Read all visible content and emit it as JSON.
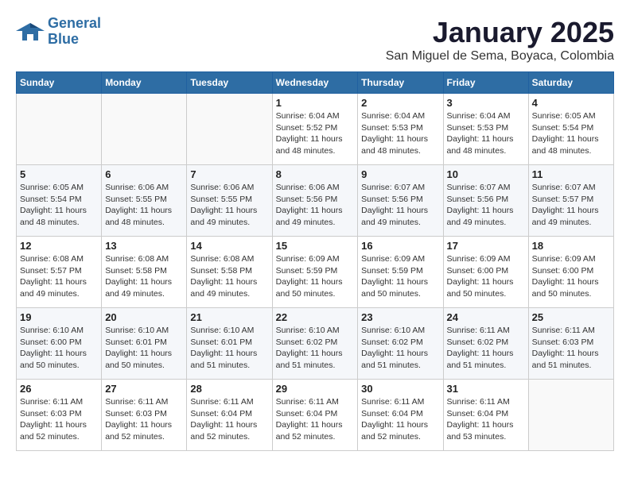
{
  "header": {
    "logo_line1": "General",
    "logo_line2": "Blue",
    "month": "January 2025",
    "location": "San Miguel de Sema, Boyaca, Colombia"
  },
  "weekdays": [
    "Sunday",
    "Monday",
    "Tuesday",
    "Wednesday",
    "Thursday",
    "Friday",
    "Saturday"
  ],
  "weeks": [
    [
      {
        "day": "",
        "sunrise": "",
        "sunset": "",
        "daylight": ""
      },
      {
        "day": "",
        "sunrise": "",
        "sunset": "",
        "daylight": ""
      },
      {
        "day": "",
        "sunrise": "",
        "sunset": "",
        "daylight": ""
      },
      {
        "day": "1",
        "sunrise": "Sunrise: 6:04 AM",
        "sunset": "Sunset: 5:52 PM",
        "daylight": "Daylight: 11 hours and 48 minutes."
      },
      {
        "day": "2",
        "sunrise": "Sunrise: 6:04 AM",
        "sunset": "Sunset: 5:53 PM",
        "daylight": "Daylight: 11 hours and 48 minutes."
      },
      {
        "day": "3",
        "sunrise": "Sunrise: 6:04 AM",
        "sunset": "Sunset: 5:53 PM",
        "daylight": "Daylight: 11 hours and 48 minutes."
      },
      {
        "day": "4",
        "sunrise": "Sunrise: 6:05 AM",
        "sunset": "Sunset: 5:54 PM",
        "daylight": "Daylight: 11 hours and 48 minutes."
      }
    ],
    [
      {
        "day": "5",
        "sunrise": "Sunrise: 6:05 AM",
        "sunset": "Sunset: 5:54 PM",
        "daylight": "Daylight: 11 hours and 48 minutes."
      },
      {
        "day": "6",
        "sunrise": "Sunrise: 6:06 AM",
        "sunset": "Sunset: 5:55 PM",
        "daylight": "Daylight: 11 hours and 48 minutes."
      },
      {
        "day": "7",
        "sunrise": "Sunrise: 6:06 AM",
        "sunset": "Sunset: 5:55 PM",
        "daylight": "Daylight: 11 hours and 49 minutes."
      },
      {
        "day": "8",
        "sunrise": "Sunrise: 6:06 AM",
        "sunset": "Sunset: 5:56 PM",
        "daylight": "Daylight: 11 hours and 49 minutes."
      },
      {
        "day": "9",
        "sunrise": "Sunrise: 6:07 AM",
        "sunset": "Sunset: 5:56 PM",
        "daylight": "Daylight: 11 hours and 49 minutes."
      },
      {
        "day": "10",
        "sunrise": "Sunrise: 6:07 AM",
        "sunset": "Sunset: 5:56 PM",
        "daylight": "Daylight: 11 hours and 49 minutes."
      },
      {
        "day": "11",
        "sunrise": "Sunrise: 6:07 AM",
        "sunset": "Sunset: 5:57 PM",
        "daylight": "Daylight: 11 hours and 49 minutes."
      }
    ],
    [
      {
        "day": "12",
        "sunrise": "Sunrise: 6:08 AM",
        "sunset": "Sunset: 5:57 PM",
        "daylight": "Daylight: 11 hours and 49 minutes."
      },
      {
        "day": "13",
        "sunrise": "Sunrise: 6:08 AM",
        "sunset": "Sunset: 5:58 PM",
        "daylight": "Daylight: 11 hours and 49 minutes."
      },
      {
        "day": "14",
        "sunrise": "Sunrise: 6:08 AM",
        "sunset": "Sunset: 5:58 PM",
        "daylight": "Daylight: 11 hours and 49 minutes."
      },
      {
        "day": "15",
        "sunrise": "Sunrise: 6:09 AM",
        "sunset": "Sunset: 5:59 PM",
        "daylight": "Daylight: 11 hours and 50 minutes."
      },
      {
        "day": "16",
        "sunrise": "Sunrise: 6:09 AM",
        "sunset": "Sunset: 5:59 PM",
        "daylight": "Daylight: 11 hours and 50 minutes."
      },
      {
        "day": "17",
        "sunrise": "Sunrise: 6:09 AM",
        "sunset": "Sunset: 6:00 PM",
        "daylight": "Daylight: 11 hours and 50 minutes."
      },
      {
        "day": "18",
        "sunrise": "Sunrise: 6:09 AM",
        "sunset": "Sunset: 6:00 PM",
        "daylight": "Daylight: 11 hours and 50 minutes."
      }
    ],
    [
      {
        "day": "19",
        "sunrise": "Sunrise: 6:10 AM",
        "sunset": "Sunset: 6:00 PM",
        "daylight": "Daylight: 11 hours and 50 minutes."
      },
      {
        "day": "20",
        "sunrise": "Sunrise: 6:10 AM",
        "sunset": "Sunset: 6:01 PM",
        "daylight": "Daylight: 11 hours and 50 minutes."
      },
      {
        "day": "21",
        "sunrise": "Sunrise: 6:10 AM",
        "sunset": "Sunset: 6:01 PM",
        "daylight": "Daylight: 11 hours and 51 minutes."
      },
      {
        "day": "22",
        "sunrise": "Sunrise: 6:10 AM",
        "sunset": "Sunset: 6:02 PM",
        "daylight": "Daylight: 11 hours and 51 minutes."
      },
      {
        "day": "23",
        "sunrise": "Sunrise: 6:10 AM",
        "sunset": "Sunset: 6:02 PM",
        "daylight": "Daylight: 11 hours and 51 minutes."
      },
      {
        "day": "24",
        "sunrise": "Sunrise: 6:11 AM",
        "sunset": "Sunset: 6:02 PM",
        "daylight": "Daylight: 11 hours and 51 minutes."
      },
      {
        "day": "25",
        "sunrise": "Sunrise: 6:11 AM",
        "sunset": "Sunset: 6:03 PM",
        "daylight": "Daylight: 11 hours and 51 minutes."
      }
    ],
    [
      {
        "day": "26",
        "sunrise": "Sunrise: 6:11 AM",
        "sunset": "Sunset: 6:03 PM",
        "daylight": "Daylight: 11 hours and 52 minutes."
      },
      {
        "day": "27",
        "sunrise": "Sunrise: 6:11 AM",
        "sunset": "Sunset: 6:03 PM",
        "daylight": "Daylight: 11 hours and 52 minutes."
      },
      {
        "day": "28",
        "sunrise": "Sunrise: 6:11 AM",
        "sunset": "Sunset: 6:04 PM",
        "daylight": "Daylight: 11 hours and 52 minutes."
      },
      {
        "day": "29",
        "sunrise": "Sunrise: 6:11 AM",
        "sunset": "Sunset: 6:04 PM",
        "daylight": "Daylight: 11 hours and 52 minutes."
      },
      {
        "day": "30",
        "sunrise": "Sunrise: 6:11 AM",
        "sunset": "Sunset: 6:04 PM",
        "daylight": "Daylight: 11 hours and 52 minutes."
      },
      {
        "day": "31",
        "sunrise": "Sunrise: 6:11 AM",
        "sunset": "Sunset: 6:04 PM",
        "daylight": "Daylight: 11 hours and 53 minutes."
      },
      {
        "day": "",
        "sunrise": "",
        "sunset": "",
        "daylight": ""
      }
    ]
  ]
}
